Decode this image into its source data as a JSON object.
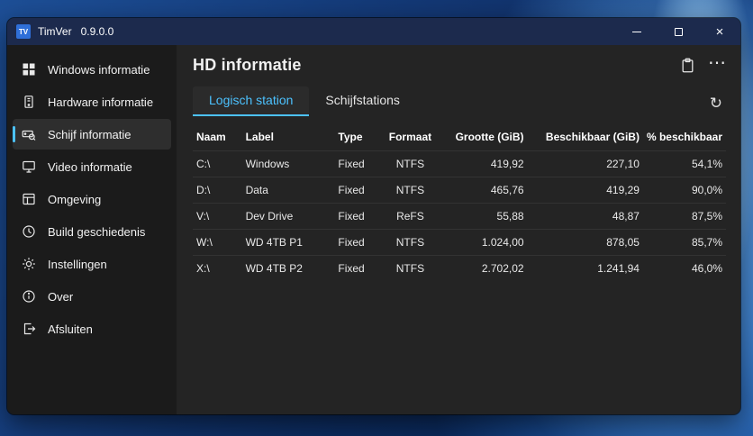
{
  "colors": {
    "accent": "#4cc2ff",
    "titlebar": "#1c2a4d",
    "sidebar-bg": "#1b1b1b",
    "main-bg": "#242424",
    "selected-bg": "#2e2e2e"
  },
  "window": {
    "app_icon_text": "TV",
    "app_name": "TimVer",
    "version": "0.9.0.0"
  },
  "sidebar": {
    "items": [
      {
        "id": "windows-informatie",
        "label": "Windows informatie",
        "icon": "windows-grid",
        "selected": false
      },
      {
        "id": "hardware-informatie",
        "label": "Hardware informatie",
        "icon": "hardware",
        "selected": false
      },
      {
        "id": "schijf-informatie",
        "label": "Schijf informatie",
        "icon": "disk-search",
        "selected": true
      },
      {
        "id": "video-informatie",
        "label": "Video informatie",
        "icon": "monitor",
        "selected": false
      },
      {
        "id": "omgeving",
        "label": "Omgeving",
        "icon": "table",
        "selected": false
      },
      {
        "id": "build-geschiedenis",
        "label": "Build geschiedenis",
        "icon": "history-clock",
        "selected": false
      },
      {
        "id": "instellingen",
        "label": "Instellingen",
        "icon": "gear",
        "selected": false
      },
      {
        "id": "over",
        "label": "Over",
        "icon": "info",
        "selected": false
      },
      {
        "id": "afsluiten",
        "label": "Afsluiten",
        "icon": "exit",
        "selected": false
      }
    ]
  },
  "main": {
    "title": "HD informatie",
    "icons": {
      "more": "⋯",
      "refresh": "↻"
    },
    "tabs": [
      {
        "id": "logisch-station",
        "label": "Logisch station",
        "active": true
      },
      {
        "id": "schijfstations",
        "label": "Schijfstations",
        "active": false
      }
    ],
    "table": {
      "headers": [
        "Naam",
        "Label",
        "Type",
        "Formaat",
        "Grootte (GiB)",
        "Beschikbaar (GiB)",
        "% beschikbaar"
      ],
      "rows": [
        [
          "C:\\",
          "Windows",
          "Fixed",
          "NTFS",
          "419,92",
          "227,10",
          "54,1%"
        ],
        [
          "D:\\",
          "Data",
          "Fixed",
          "NTFS",
          "465,76",
          "419,29",
          "90,0%"
        ],
        [
          "V:\\",
          "Dev Drive",
          "Fixed",
          "ReFS",
          "55,88",
          "48,87",
          "87,5%"
        ],
        [
          "W:\\",
          "WD 4TB P1",
          "Fixed",
          "NTFS",
          "1.024,00",
          "878,05",
          "85,7%"
        ],
        [
          "X:\\",
          "WD 4TB P2",
          "Fixed",
          "NTFS",
          "2.702,02",
          "1.241,94",
          "46,0%"
        ]
      ]
    }
  }
}
